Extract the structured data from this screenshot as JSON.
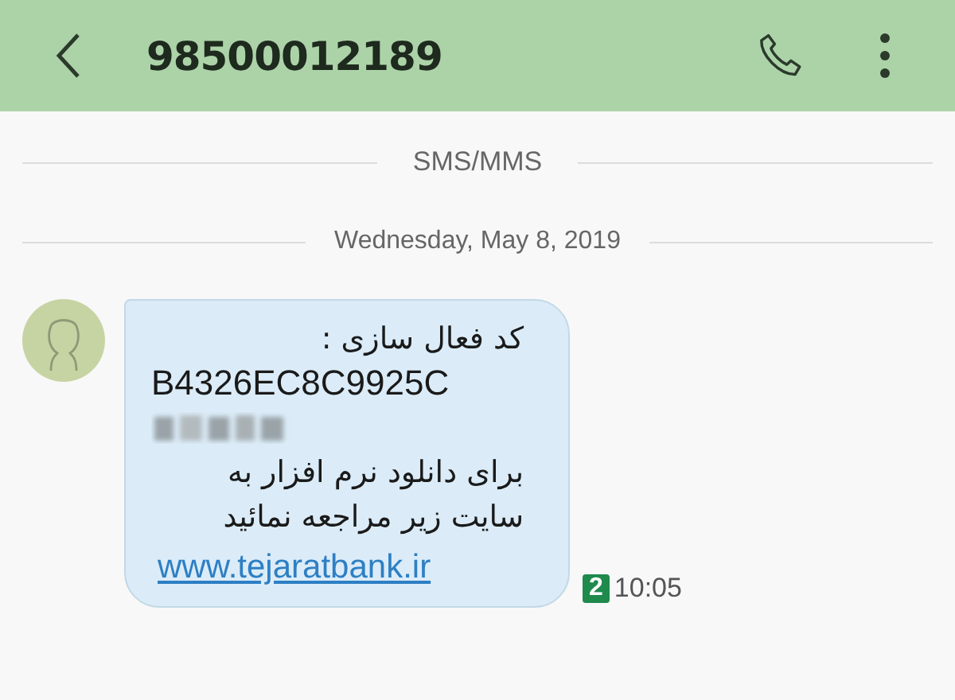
{
  "header": {
    "title": "98500012189"
  },
  "channel_label": "SMS/MMS",
  "date_label": "Wednesday, May 8, 2019",
  "message": {
    "lines": [
      {
        "kind": "rtl",
        "text": "کد فعال سازی :"
      },
      {
        "kind": "ltr",
        "text": "B4326EC8C9925C"
      },
      {
        "kind": "redacted"
      },
      {
        "kind": "rtl",
        "text": "برای دانلود نرم افزار به"
      },
      {
        "kind": "rtl",
        "text": "سایت زیر مراجعه نمائید"
      },
      {
        "kind": "link",
        "text": "www.tejaratbank.ir"
      }
    ],
    "sim_badge": "2",
    "time": "10:05"
  }
}
